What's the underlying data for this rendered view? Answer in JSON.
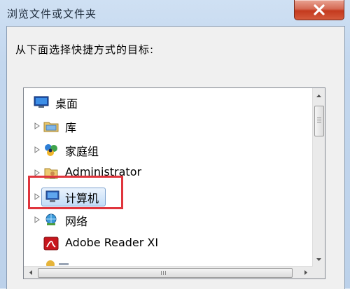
{
  "window": {
    "title": "浏览文件或文件夹",
    "close_label": "close"
  },
  "dialog": {
    "prompt": "从下面选择快捷方式的目标:"
  },
  "tree": {
    "items": [
      {
        "label": "桌面",
        "icon": "desktop-icon",
        "has_expander": false
      },
      {
        "label": "库",
        "icon": "library-icon",
        "has_expander": true
      },
      {
        "label": "家庭组",
        "icon": "homegroup-icon",
        "has_expander": true
      },
      {
        "label": "Administrator",
        "icon": "user-folder-icon",
        "has_expander": true
      },
      {
        "label": "计算机",
        "icon": "computer-icon",
        "has_expander": true,
        "selected": true
      },
      {
        "label": "网络",
        "icon": "network-icon",
        "has_expander": true
      },
      {
        "label": "Adobe Reader XI",
        "icon": "adobe-reader-icon",
        "has_expander": false
      }
    ]
  },
  "colors": {
    "highlight": "#e0353d",
    "selection": "#c2dcf7",
    "close_button": "#c43a1e"
  }
}
